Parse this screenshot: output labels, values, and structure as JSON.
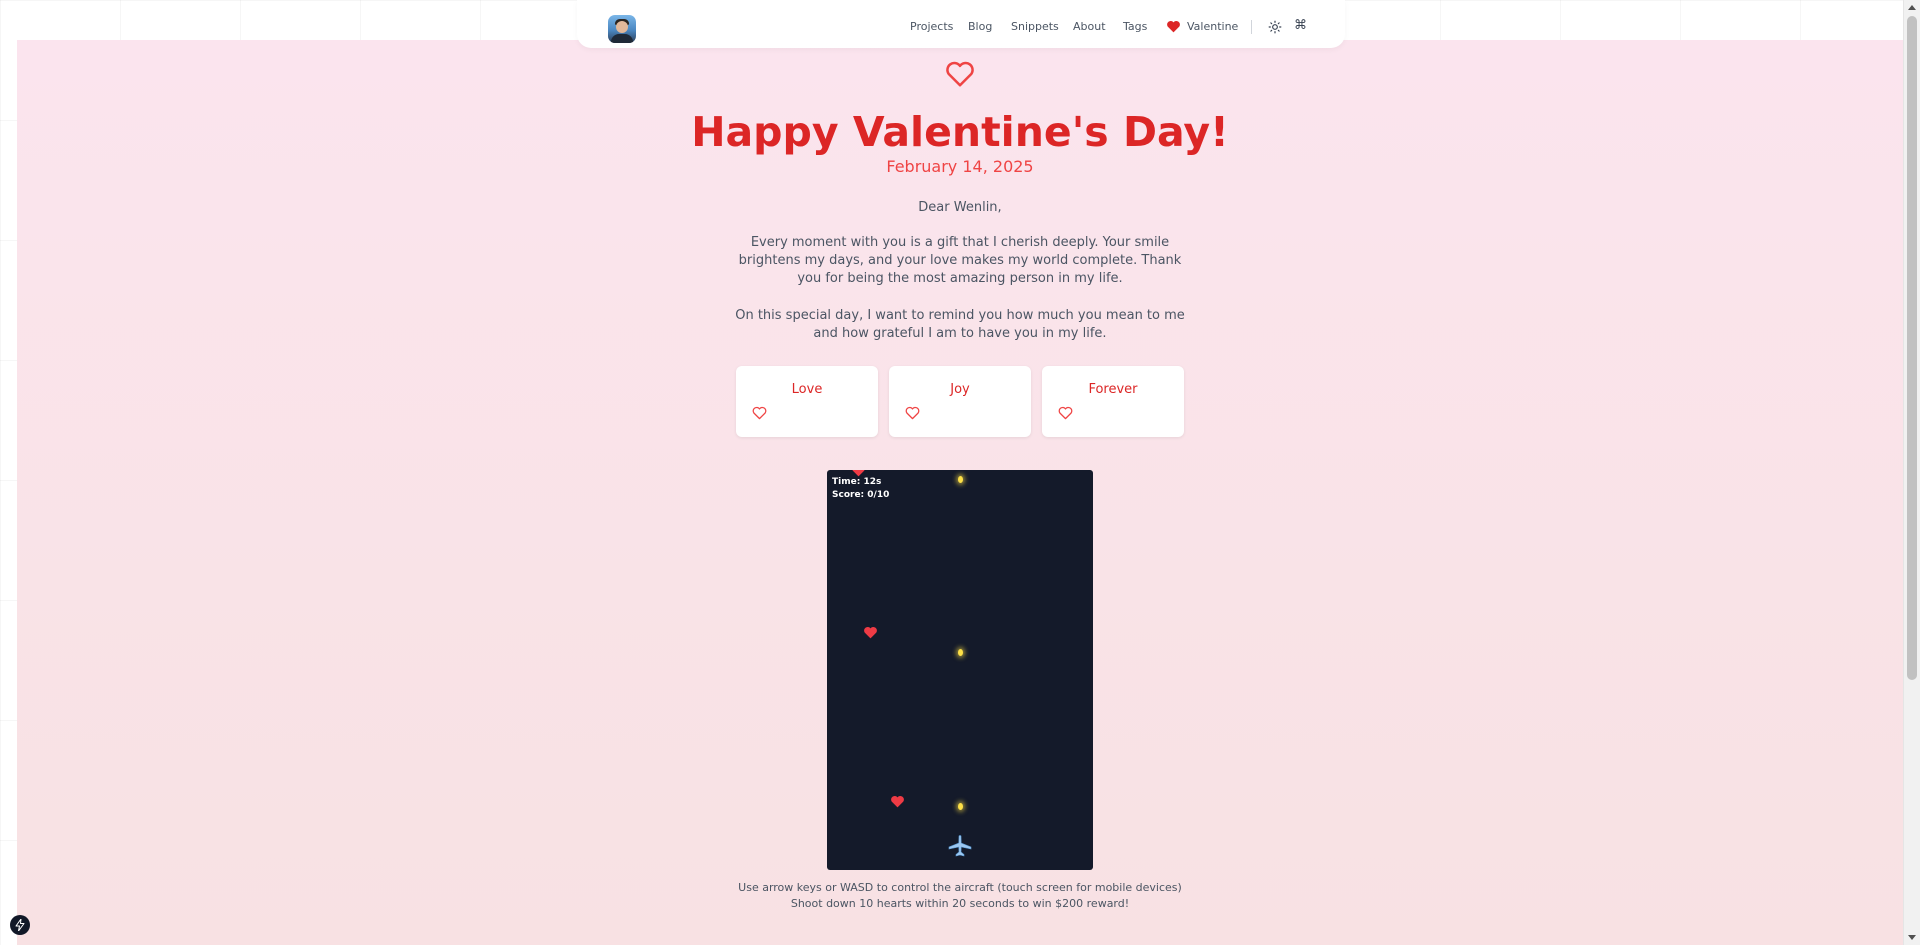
{
  "navbar": {
    "links": [
      "Projects",
      "Blog",
      "Snippets",
      "About",
      "Tags"
    ],
    "valentine_label": "Valentine",
    "command_glyph": "⌘",
    "icons": {
      "heart": "heart-icon",
      "theme": "sun-icon",
      "command": "command-icon"
    }
  },
  "hero": {
    "title": "Happy Valentine's Day!",
    "date": "February 14, 2025"
  },
  "letter": {
    "greeting": "Dear Wenlin,",
    "paragraph1": "Every moment with you is a gift that I cherish deeply. Your smile brightens my days, and your love makes my world complete. Thank you for being the most amazing person in my life.",
    "paragraph2": "On this special day, I want to remind you how much you mean to me and how grateful I am to have you in my life."
  },
  "cards": [
    {
      "title": "Love"
    },
    {
      "title": "Joy"
    },
    {
      "title": "Forever"
    }
  ],
  "game": {
    "time": "Time: 12s",
    "score": "Score: 0/10"
  },
  "instructions": {
    "line1": "Use arrow keys or WASD to control the aircraft (touch screen for mobile devices)",
    "line2": "Shoot down 10 hearts within 20 seconds to win $200 reward!"
  },
  "colors": {
    "accent": "#dc2626",
    "accent_light": "#ef4444",
    "game_bg": "#141a2a",
    "bullet": "#fde047"
  }
}
